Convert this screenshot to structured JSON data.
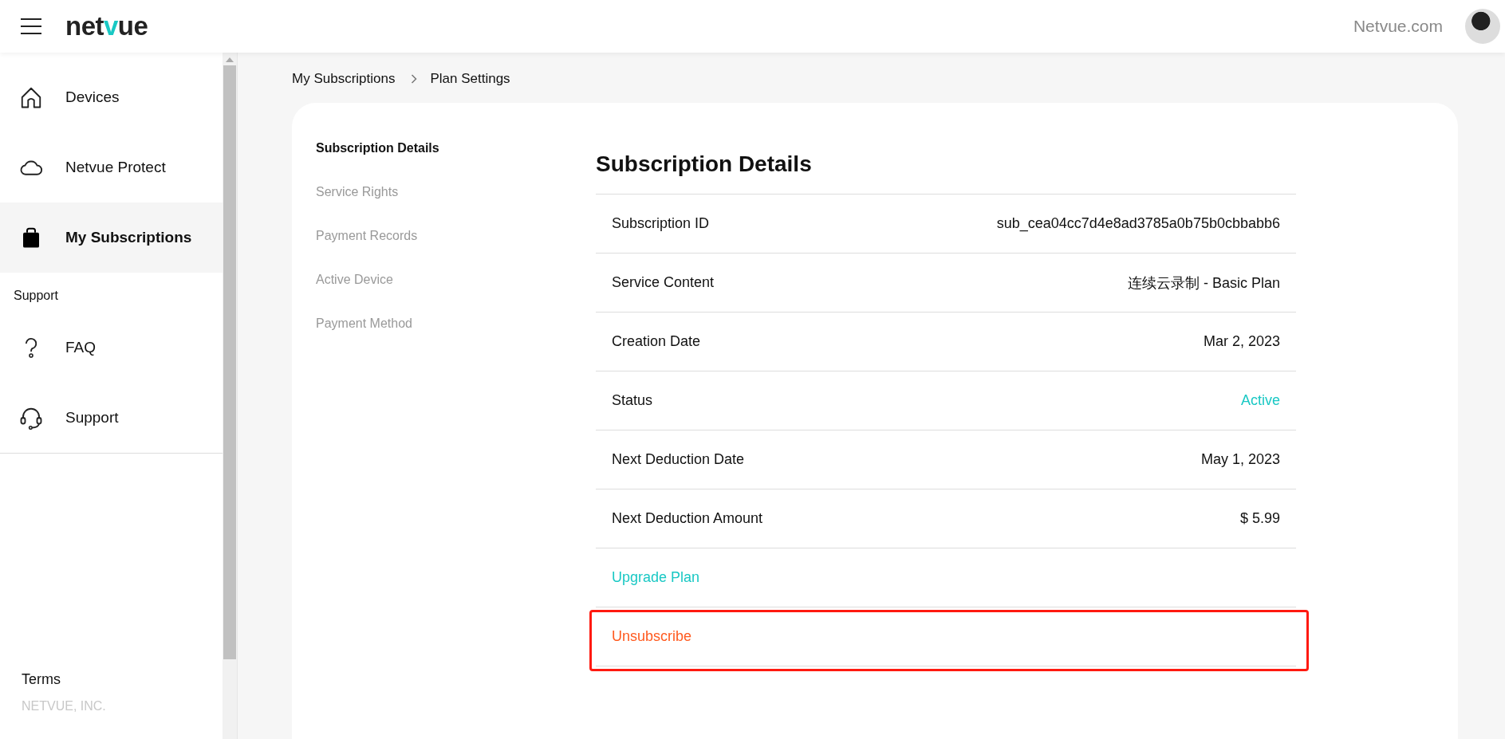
{
  "header": {
    "logo": [
      {
        "text": "net"
      },
      {
        "text": "v",
        "color": "#19c8c4"
      },
      {
        "text": "ue"
      }
    ],
    "site_link": "Netvue.com"
  },
  "sidebar": {
    "items": [
      {
        "label": "Devices",
        "kind": "home",
        "selected": false
      },
      {
        "label": "Netvue Protect",
        "kind": "cloud",
        "selected": false
      },
      {
        "label": "My Subscriptions",
        "kind": "bag",
        "selected": true
      }
    ],
    "section_label": "Support",
    "support_items": [
      {
        "label": "FAQ",
        "kind": "question",
        "selected": false
      },
      {
        "label": "Support",
        "kind": "headset",
        "selected": false
      }
    ],
    "footer_link": "Terms",
    "copyright": "NETVUE, INC."
  },
  "breadcrumb": [
    "My Subscriptions",
    "Plan Settings"
  ],
  "card_tabs": [
    {
      "label": "Subscription Details",
      "selected": true
    },
    {
      "label": "Service Rights",
      "selected": false
    },
    {
      "label": "Payment Records",
      "selected": false
    },
    {
      "label": "Active Device",
      "selected": false
    },
    {
      "label": "Payment Method",
      "selected": false
    }
  ],
  "details": {
    "title": "Subscription Details",
    "rows": [
      {
        "label": "Subscription ID",
        "value": "sub_cea04cc7d4e8ad3785a0b75b0cbbabb6",
        "kind": "plain"
      },
      {
        "label": "Service Content",
        "value": "连续云录制 - Basic Plan",
        "kind": "plain"
      },
      {
        "label": "Creation Date",
        "value": "Mar 2, 2023",
        "kind": "plain"
      },
      {
        "label": "Status",
        "value": "Active",
        "kind": "status"
      },
      {
        "label": "Next Deduction Date",
        "value": "May 1, 2023",
        "kind": "plain"
      },
      {
        "label": "Next Deduction Amount",
        "value": "$ 5.99",
        "kind": "plain"
      }
    ],
    "actions": [
      {
        "label": "Upgrade Plan",
        "kind": "upgrade",
        "highlighted": false
      },
      {
        "label": "Unsubscribe",
        "kind": "danger",
        "highlighted": true
      }
    ]
  }
}
